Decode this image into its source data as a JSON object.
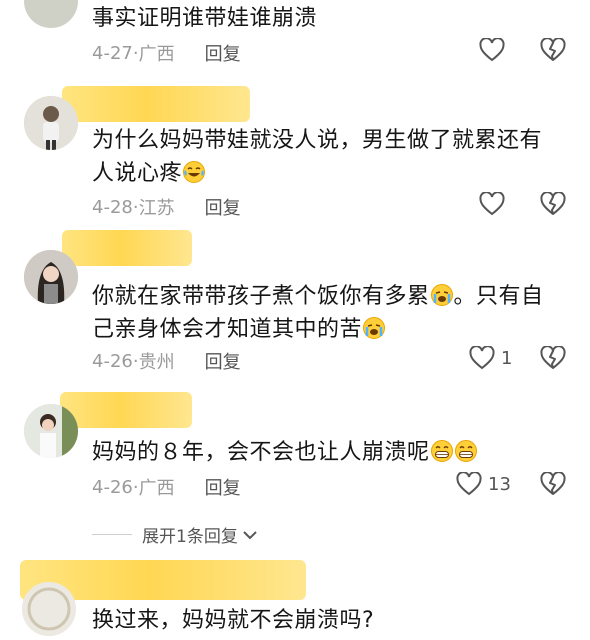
{
  "comments": [
    {
      "text": "事实证明谁带娃谁崩溃",
      "date": "4-27",
      "location": "广西",
      "reply_label": "回复",
      "likes": ""
    },
    {
      "text": "为什么妈妈带娃就没人说，男生做了就累还有人说心疼",
      "emoji": "crying-laughing-emoji",
      "date": "4-28",
      "location": "江苏",
      "reply_label": "回复",
      "likes": ""
    },
    {
      "text_part1": "你就在家带带孩子煮个饭你有多累",
      "text_part2": "。只有自己亲身体会才知道其中的苦",
      "emoji": "crying-emoji",
      "date": "4-26",
      "location": "贵州",
      "reply_label": "回复",
      "likes": "1"
    },
    {
      "text": "妈妈的８年，会不会也让人崩溃呢",
      "emoji": "grinning-sweat-emoji",
      "date": "4-26",
      "location": "广西",
      "reply_label": "回复",
      "likes": "13"
    },
    {
      "text": "换过来，妈妈就不会崩溃吗?"
    }
  ],
  "expand_replies": "展开1条回复",
  "meta_separator": "·",
  "colors": {
    "redact": "#ffd54a",
    "text": "#161616",
    "meta": "#9a9a9a"
  }
}
